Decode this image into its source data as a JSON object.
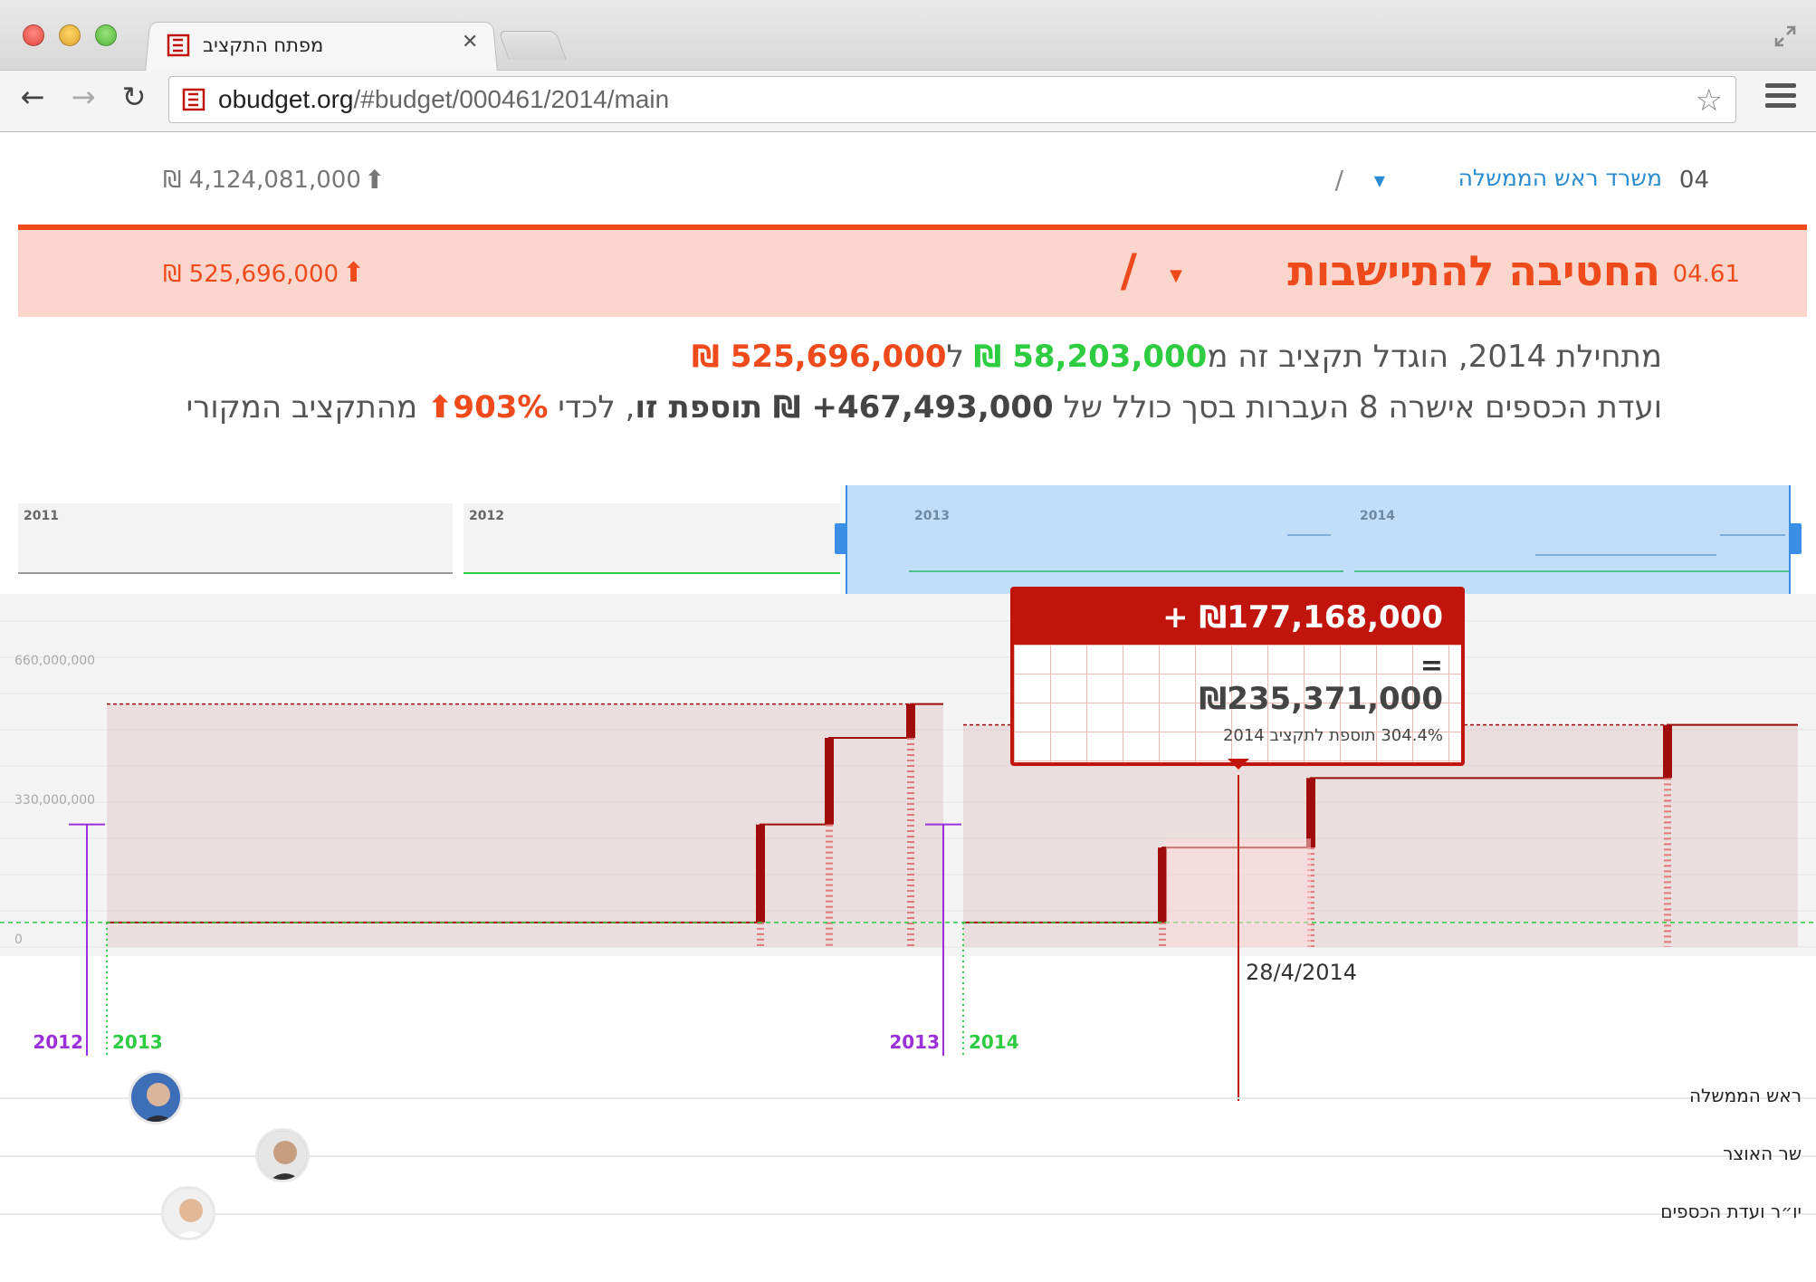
{
  "browser": {
    "tab_title": "מפתח התקציב",
    "url_host": "obudget.org",
    "url_rest": "/#budget/000461/2014/main"
  },
  "breadcrumb_parent": {
    "code": "04",
    "name": "משרד ראש הממשלה",
    "slash": "/",
    "amount": "₪ 4,124,081,000"
  },
  "breadcrumb_current": {
    "code": "04.61",
    "name": "החטיבה להתיישבות",
    "slash": "/",
    "amount": "₪ 525,696,000"
  },
  "summary": {
    "l1_a": "מתחילת 2014, הוגדל תקציב זה מ",
    "l1_from": "58,203,000 ₪",
    "l1_b": " ל",
    "l1_to": "525,696,000 ₪",
    "l2_a": "ועדת הכספים אישרה 8 העברות בסך כולל של ",
    "l2_total": "467,493,000+ ₪ תוספת זו",
    "l2_b": ", לכדי ",
    "l2_pct": "903%",
    "l2_c": " מהתקציב המקורי"
  },
  "timeline_nav": {
    "years": [
      "2011",
      "2012",
      "2013",
      "2014"
    ]
  },
  "chart_data": {
    "type": "line",
    "y_ticks": [
      "660,000,000",
      "330,000,000",
      "0"
    ],
    "ylim": [
      0,
      750000000
    ],
    "x": [
      "2012",
      "2013",
      "2013",
      "2014"
    ],
    "series": [
      {
        "values": [
          58203000,
          58203000,
          58203000,
          58203000
        ]
      },
      {
        "values": [
          290000000,
          575000000,
          290000000,
          525696000
        ]
      }
    ],
    "boundary_labels": [
      {
        "purple": "2012",
        "green": "2013"
      },
      {
        "purple": "2013",
        "green": "2014"
      }
    ],
    "cursor_date": "28/4/2014",
    "colors": {
      "budget": "#a00b0b",
      "original": "#2ecc40",
      "prev_year": "#9b30d9"
    }
  },
  "tooltip": {
    "change": "+ ₪177,168,000",
    "equals": "=",
    "total": "₪235,371,000",
    "note": "304.4% תוספת לתקציב 2014"
  },
  "people": [
    {
      "role": "ראש הממשלה",
      "avatar": "prime-minister"
    },
    {
      "role": "שר האוצר",
      "avatar": "finance-minister"
    },
    {
      "role": "יו״ר ועדת הכספים",
      "avatar": "finance-committee-chair"
    }
  ],
  "icons": {
    "arrow_up": "⬆",
    "star": "☆",
    "close": "✕",
    "back": "←",
    "forward": "→",
    "reload": "↻",
    "caret": "▼"
  }
}
